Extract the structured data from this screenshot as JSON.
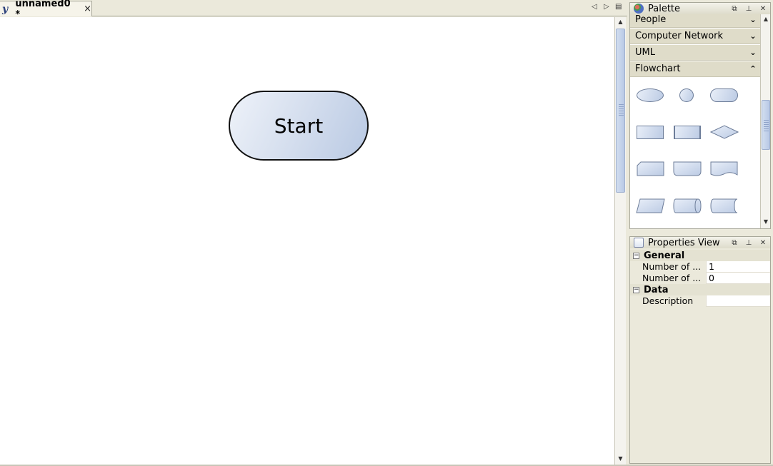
{
  "editor": {
    "tab_title": "unnamed0 *",
    "tab_close": "×",
    "nav_prev": "◁",
    "nav_next": "▷",
    "nav_list": "▤",
    "start_node_label": "Start"
  },
  "palette": {
    "title": "Palette",
    "categories": [
      {
        "label": "People",
        "state": "collapsed",
        "chevron": "⌄⌄"
      },
      {
        "label": "Computer Network",
        "state": "collapsed",
        "chevron": "⌄⌄"
      },
      {
        "label": "UML",
        "state": "collapsed",
        "chevron": "⌄⌄"
      },
      {
        "label": "Flowchart",
        "state": "expanded",
        "chevron": "⌃⌃"
      }
    ],
    "flowchart_shapes": [
      "ellipse",
      "circle",
      "terminator",
      "process",
      "predefined-process",
      "decision",
      "card",
      "off-page-connector",
      "document",
      "data",
      "direct-data",
      "stored-data"
    ]
  },
  "properties": {
    "title": "Properties View",
    "sections": [
      {
        "name": "General",
        "rows": [
          {
            "name": "Number of ...",
            "value": "1"
          },
          {
            "name": "Number of ...",
            "value": "0"
          }
        ]
      },
      {
        "name": "Data",
        "rows": [
          {
            "name": "Description",
            "value": ""
          }
        ]
      }
    ]
  },
  "colors": {
    "chrome": "#ebe9db",
    "node_fill_start": "#eef2f9",
    "node_fill_end": "#b9c9e3",
    "scroll_thumb": "#b8c9e6"
  }
}
